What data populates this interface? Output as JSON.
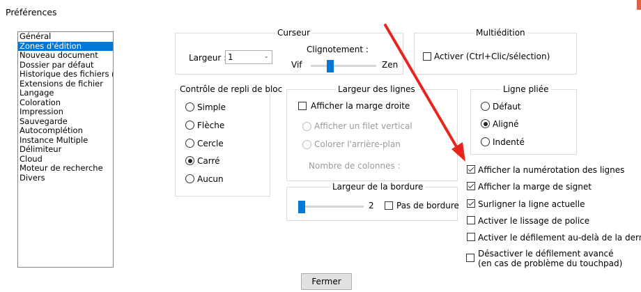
{
  "window": {
    "title": "Préférences"
  },
  "categories": {
    "items": [
      "Général",
      "Zones d'édition",
      "Nouveau document",
      "Dossier par défaut",
      "Historique des fichiers ré",
      "Extensions de fichier",
      "Langage",
      "Coloration",
      "Impression",
      "Sauvegarde",
      "Autocomplétion",
      "Instance Multiple",
      "Délimiteur",
      "Cloud",
      "Moteur de recherche",
      "Divers"
    ],
    "selected_index": 1
  },
  "cursor": {
    "title": "Curseur",
    "width_label": "Largeur :",
    "width_value": "1",
    "blink_label": "Clignotement :",
    "blink_min": "Vif",
    "blink_max": "Zen",
    "blink_level": 0.3
  },
  "multiedit": {
    "title": "Multiédition",
    "enable_label": "Activer (Ctrl+Clic/sélection)",
    "enabled": false
  },
  "fold": {
    "title": "Contrôle de repli de bloc",
    "options": [
      "Simple",
      "Flèche",
      "Cercle",
      "Carré",
      "Aucun"
    ],
    "selected": "Carré"
  },
  "line_width": {
    "title": "Largeur des lignes",
    "show_right_margin_label": "Afficher la marge droite",
    "show_right_margin": false,
    "vertical_line_label": "Afficher un filet vertical",
    "bg_color_label": "Colorer l'arrière-plan",
    "columns_label": "Nombre de colonnes :"
  },
  "wrapped": {
    "title": "Ligne pliée",
    "options": [
      "Défaut",
      "Aligné",
      "Indenté"
    ],
    "selected": "Aligné"
  },
  "border": {
    "title": "Largeur de la bordure",
    "value": "2",
    "no_border_label": "Pas de bordure",
    "no_border": false
  },
  "options": [
    {
      "label": "Afficher la numérotation des lignes",
      "checked": true
    },
    {
      "label": "Afficher la marge de signet",
      "checked": true
    },
    {
      "label": "Surligner la ligne actuelle",
      "checked": true
    },
    {
      "label": "Activer le lissage de police",
      "checked": false
    },
    {
      "label": "Activer le défilement au-delà de la dernié",
      "checked": false
    }
  ],
  "smooth_scroll": {
    "line1": "Désactiver le défilement avancé",
    "line2": "(en cas de problème du touchpad)",
    "checked": false
  },
  "close_button": "Fermer",
  "annotation": {
    "arrow_color": "#e8251d"
  },
  "colors": {
    "accent": "#0078d7"
  }
}
